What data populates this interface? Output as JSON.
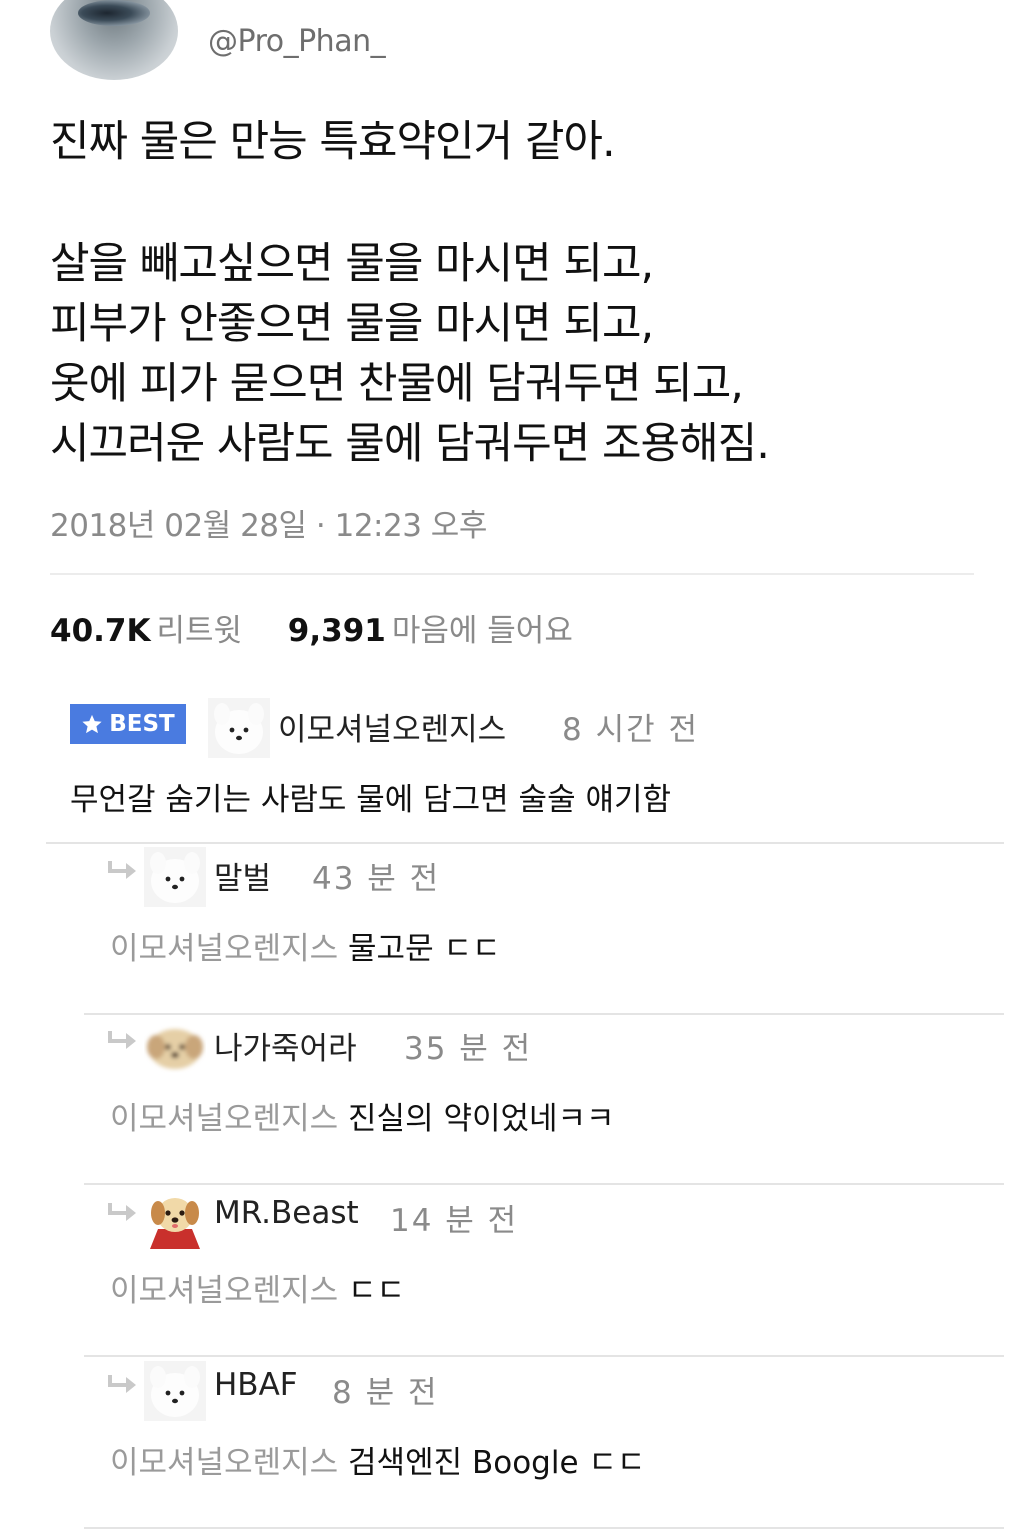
{
  "profile": {
    "handle": "@Pro_Phan_",
    "avatar_icon": "eye-makeup-avatar-icon"
  },
  "tweet": {
    "lines": [
      "진짜 물은 만능 특효약인거 같아.",
      "살을 빼고싶으면 물을 마시면 되고,",
      "피부가 안좋으면 물을 마시면 되고,",
      "옷에 피가 묻으면 찬물에 담궈두면 되고,",
      "시끄러운 사람도 물에 담궈두면 조용해짐."
    ],
    "timestamp": "2018년 02월 28일 · 12:23 오후"
  },
  "stats": {
    "retweets_count": "40.7K",
    "retweets_label": "리트윗",
    "likes_count": "9,391",
    "likes_label": "마음에 들어요"
  },
  "best_comment": {
    "badge": "BEST",
    "badge_icon": "star-icon",
    "author": "이모셔널오렌지스",
    "time": "8 시간 전",
    "text": "무언갈 숨기는 사람도 물에 담그면 술술 얘기함",
    "avatar_icon": "white-dog-avatar-icon"
  },
  "replies": [
    {
      "author": "말벌",
      "time": "43 분 전",
      "mention": "이모셔널오렌지스",
      "text": " 물고문 ㄷㄷ",
      "avatar_icon": "white-dog-avatar-icon"
    },
    {
      "author": "나가죽어라",
      "time": "35 분 전",
      "mention": "이모셔널오렌지스",
      "text": " 진실의 약이었네ㅋㅋ",
      "avatar_icon": "blurred-dog-avatar-icon"
    },
    {
      "author": "MR.Beast",
      "time": "14 분 전",
      "mention": "이모셔널오렌지스",
      "text": " ㄷㄷ",
      "avatar_icon": "puppy-in-red-avatar-icon"
    },
    {
      "author": "HBAF",
      "time": "8 분 전",
      "mention": "이모셔널오렌지스",
      "text": " 검색엔진 Boogle ㄷㄷ",
      "avatar_icon": "white-dog-avatar-icon"
    }
  ],
  "colors": {
    "badge_blue": "#4a7be0",
    "muted_gray": "#8a8a8a",
    "divider": "#e4e4e4"
  }
}
